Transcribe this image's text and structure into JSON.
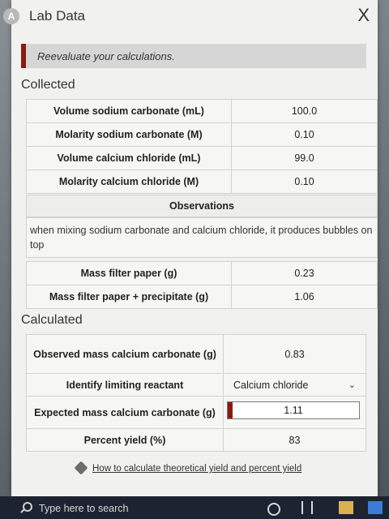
{
  "window": {
    "title": "Lab Data",
    "close_label": "X",
    "logo_letter": "A"
  },
  "alert": {
    "text": "Reevaluate your calculations."
  },
  "collected": {
    "heading": "Collected",
    "rows": [
      {
        "label": "Volume sodium carbonate (mL)",
        "value": "100.0"
      },
      {
        "label": "Molarity sodium carbonate (M)",
        "value": "0.10"
      },
      {
        "label": "Volume calcium chloride (mL)",
        "value": "99.0"
      },
      {
        "label": "Molarity calcium chloride (M)",
        "value": "0.10"
      }
    ],
    "observations_heading": "Observations",
    "observations_text": "when mixing sodium carbonate and calcium chloride, it produces bubbles on top",
    "rows2": [
      {
        "label": "Mass filter paper (g)",
        "value": "0.23"
      },
      {
        "label": "Mass filter paper + precipitate (g)",
        "value": "1.06"
      }
    ]
  },
  "calculated": {
    "heading": "Calculated",
    "observed_mass": {
      "label": "Observed mass calcium carbonate (g)",
      "value": "0.83"
    },
    "limiting_reactant": {
      "label": "Identify limiting reactant",
      "value": "Calcium chloride"
    },
    "expected_mass": {
      "label": "Expected mass calcium carbonate (g)",
      "value": "1.11"
    },
    "percent_yield": {
      "label": "Percent yield (%)",
      "value": "83"
    }
  },
  "help_link": "How to calculate theoretical yield and percent yield",
  "taskbar": {
    "search_placeholder": "Type here to search"
  },
  "colors": {
    "alert_accent": "#8b1a12",
    "background": "#f1f1ef"
  }
}
